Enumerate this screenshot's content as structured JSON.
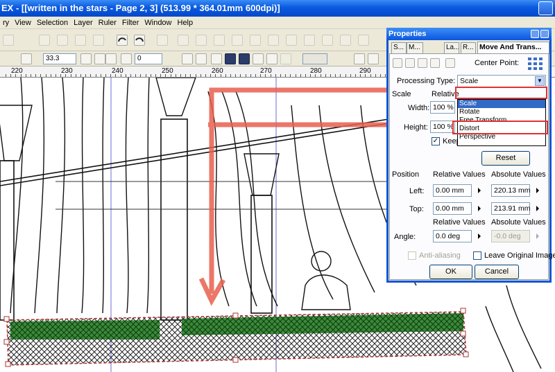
{
  "window": {
    "title": "EX - [[written in the stars - Page 2, 3] (513.99 * 364.01mm 600dpi)]"
  },
  "menu": [
    "ry",
    "View",
    "Selection",
    "Layer",
    "Ruler",
    "Filter",
    "Window",
    "Help"
  ],
  "toolbar": {
    "zoom_value": "33.3",
    "rotate_value": "0"
  },
  "ruler": {
    "labels": [
      "220",
      "230",
      "240",
      "250",
      "260",
      "270",
      "280",
      "290"
    ]
  },
  "properties": {
    "title": "Properties",
    "tabs": [
      "S...",
      "M...",
      "La...",
      "R...",
      "Move And Trans..."
    ],
    "center_point_label": "Center Point:",
    "processing_type_label": "Processing Type:",
    "processing_type_value": "Scale",
    "processing_type_options": [
      "Scale",
      "Rotate",
      "Free Transform",
      "Distort",
      "Perspective"
    ],
    "scale_label": "Scale",
    "relative_label": "Relative",
    "width_label": "Width:",
    "width_value": "100 %",
    "height_label": "Height:",
    "height_value": "100 %",
    "keep_aspect_label": "Keep Aspect Ratio",
    "keep_aspect_checked": true,
    "reset_label": "Reset",
    "position_label": "Position",
    "relative_values_label": "Relative Values",
    "absolute_values_label": "Absolute Values",
    "left_label": "Left:",
    "left_relative": "0.00 mm",
    "left_absolute": "220.13 mm",
    "top_label": "Top:",
    "top_relative": "0.00 mm",
    "top_absolute": "213.91 mm",
    "relative_values_label_2": "Relative Values",
    "absolute_values_label_2": "Absolute Values",
    "angle_label": "Angle:",
    "angle_relative": "0.0 deg",
    "angle_absolute": "-0.0 deg",
    "anti_aliasing_label": "Anti-aliasing",
    "leave_original_label": "Leave Original Image",
    "ok_label": "OK",
    "cancel_label": "Cancel"
  },
  "colors": {
    "accent_blue": "#0a56e0",
    "annotation_red": "#e8604e",
    "selection_green": "#3a8a3a"
  }
}
